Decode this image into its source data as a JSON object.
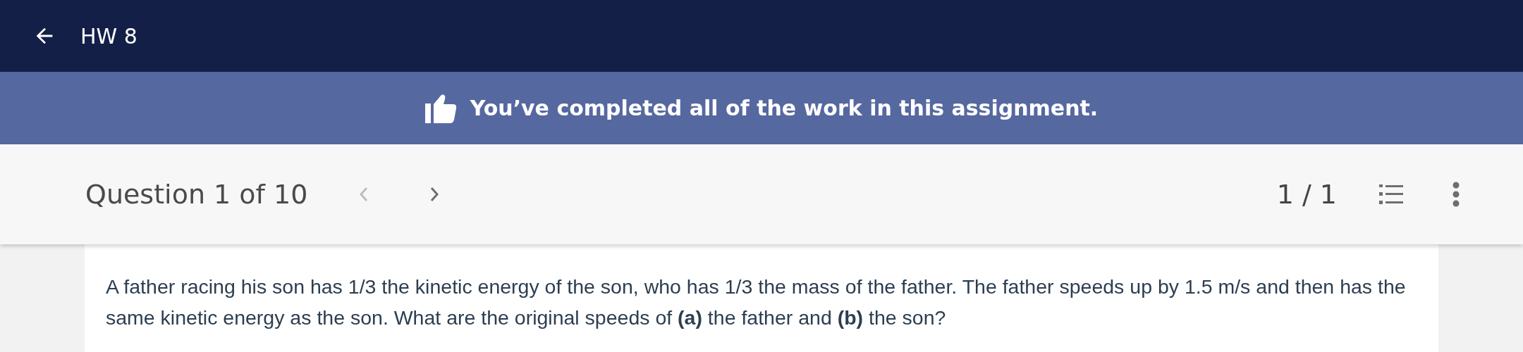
{
  "header": {
    "title": "HW 8"
  },
  "banner": {
    "message": "You’ve completed all of the work in this assignment."
  },
  "question_bar": {
    "label": "Question 1 of 10",
    "nav": [
      {
        "kind": "prev",
        "disabled": true
      },
      {
        "kind": "next",
        "disabled": false
      }
    ],
    "attempts": "1 / 1"
  },
  "question": {
    "text": "A father racing his son has 1/3 the kinetic energy of the son, who has 1/3 the mass of the father. The father speeds up by 1.5 m/s and then has the same kinetic energy as the son. What are the original speeds of **(a)** the father and **(b)** the son?"
  }
}
